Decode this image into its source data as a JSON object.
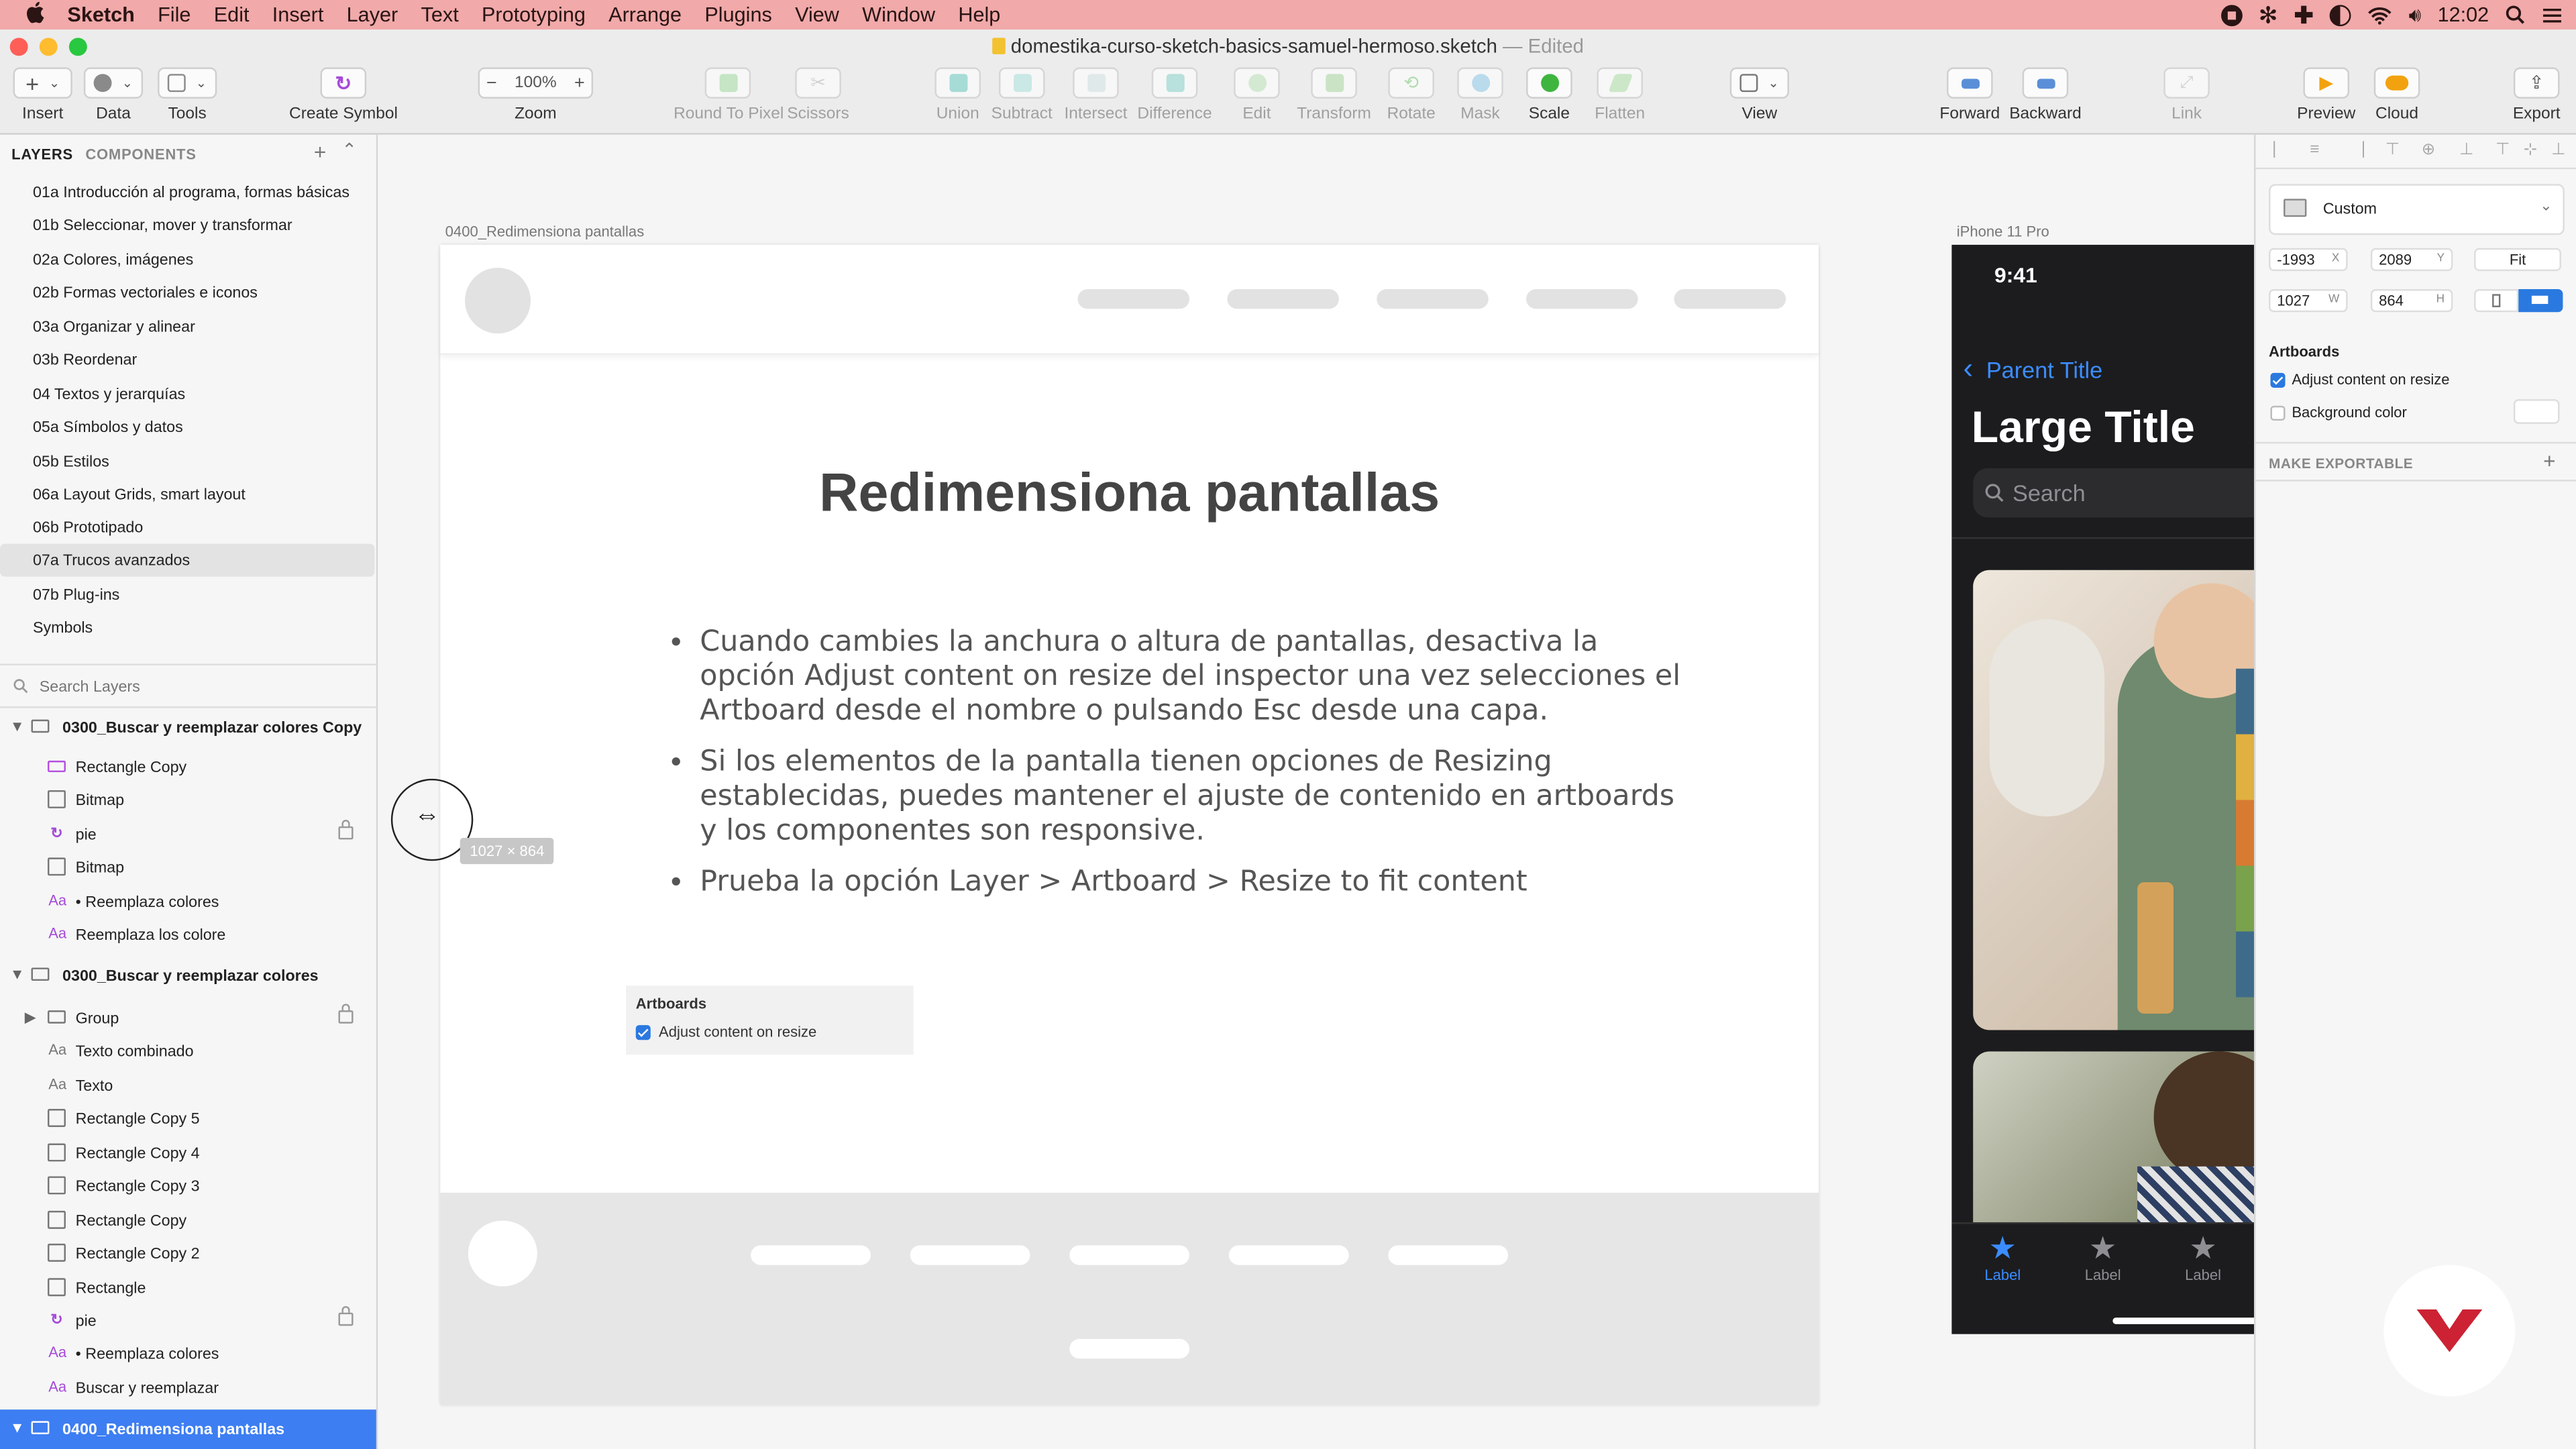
{
  "menubar": {
    "apple": "",
    "app": "Sketch",
    "items": [
      "File",
      "Edit",
      "Insert",
      "Layer",
      "Text",
      "Prototyping",
      "Arrange",
      "Plugins",
      "View",
      "Window",
      "Help"
    ],
    "clock": "12:02"
  },
  "window": {
    "title": "domestika-curso-sketch-basics-samuel-hermoso.sketch",
    "edited": "— Edited"
  },
  "toolbar": {
    "insert": "Insert",
    "data": "Data",
    "tools": "Tools",
    "create_symbol": "Create Symbol",
    "zoom_value": "100%",
    "zoom": "Zoom",
    "round_to_pixel": "Round To Pixel",
    "scissors": "Scissors",
    "union": "Union",
    "subtract": "Subtract",
    "intersect": "Intersect",
    "difference": "Difference",
    "edit": "Edit",
    "transform": "Transform",
    "rotate": "Rotate",
    "mask": "Mask",
    "scale": "Scale",
    "flatten": "Flatten",
    "view": "View",
    "forward": "Forward",
    "backward": "Backward",
    "link": "Link",
    "preview": "Preview",
    "cloud": "Cloud",
    "export": "Export"
  },
  "left_panel": {
    "tab_layers": "LAYERS",
    "tab_components": "COMPONENTS",
    "pages": [
      "01a Introducción al programa, formas básicas",
      "01b Seleccionar, mover y transformar",
      "02a Colores, imágenes",
      "02b Formas vectoriales e iconos",
      "03a Organizar y alinear",
      "03b Reordenar",
      "04 Textos y jerarquías",
      "05a Símbolos y datos",
      "05b Estilos",
      "06a Layout Grids, smart layout",
      "06b Prototipado",
      "07a Trucos avanzados",
      "07b Plug-ins",
      "Symbols"
    ],
    "search_placeholder": "Search Layers",
    "groups": [
      {
        "name": "0300_Buscar y reemplazar colores Copy",
        "layers": [
          "Rectangle Copy",
          "Bitmap",
          "pie",
          "Bitmap",
          "• Reemplaza colores",
          "Reemplaza los colore"
        ]
      },
      {
        "name": "0300_Buscar y reemplazar colores",
        "layers": [
          "Group",
          "Texto combinado",
          "Texto",
          "Rectangle Copy 5",
          "Rectangle Copy 4",
          "Rectangle Copy 3",
          "Rectangle Copy",
          "Rectangle Copy 2",
          "Rectangle",
          "pie",
          "• Reemplaza colores",
          "Buscar y reemplazar"
        ]
      }
    ],
    "selected_artboard": "0400_Redimensiona pantallas"
  },
  "canvas": {
    "artboard_label": "0400_Redimensiona pantallas",
    "iphone_label": "iPhone 11 Pro",
    "headline": "Redimensiona pantallas",
    "bullets": [
      "Cuando cambies la anchura o altura de pantallas, desactiva la opción Adjust content on resize del inspector una vez selecciones el Artboard desde el nombre o pulsando Esc desde una capa.",
      "Si los elementos de la pantalla tienen opciones de Resizing establecidas, puedes mantener el ajuste de contenido en artboards y los componentes son responsive.",
      "Prueba la opción Layer > Artboard > Resize to fit content"
    ],
    "inset_title": "Artboards",
    "inset_option": "Adjust content on resize",
    "size_tooltip": "1027 × 864",
    "iphone": {
      "time": "9:41",
      "back": "Parent Title",
      "title": "Large Title",
      "search": "Search",
      "tabs": [
        "Label",
        "Label",
        "Label"
      ]
    }
  },
  "inspector": {
    "preset": "Custom",
    "x": "-1993",
    "x_label": "X",
    "y": "2089",
    "y_label": "Y",
    "w": "1027",
    "w_label": "W",
    "h": "864",
    "h_label": "H",
    "fit": "Fit",
    "section": "Artboards",
    "adjust": "Adjust content on resize",
    "background": "Background color",
    "exportable": "MAKE EXPORTABLE"
  },
  "colors": {
    "menubar_bg": "#f1a9a9",
    "accent_blue": "#2a79e0",
    "selection_bg": "#3d7ef2",
    "ios_blue": "#3b8dff",
    "domestika_red": "#cc2233"
  }
}
